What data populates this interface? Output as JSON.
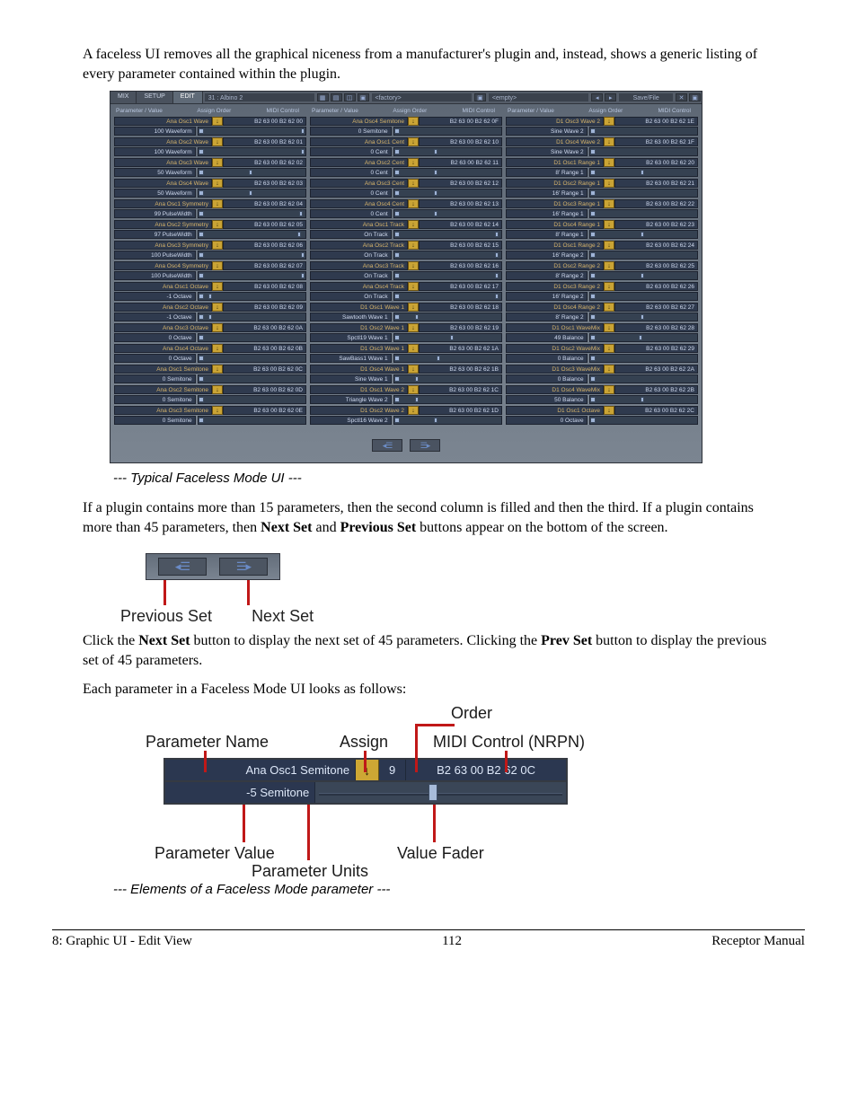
{
  "intro_para": "A faceless UI removes all the graphical niceness from a manufacturer's plugin and, instead, shows a generic listing of every parameter contained within the plugin.",
  "ui": {
    "tabs": [
      "MIX",
      "SETUP",
      "EDIT"
    ],
    "title_field": "31 : Albino 2",
    "factory_field": "<factory>",
    "empty_field": "<empty>",
    "savefile": "Save/File",
    "col_headers": [
      "Parameter / Value",
      "Assign Order",
      "MIDI Control"
    ],
    "columns": [
      [
        {
          "name": "Ana Osc1 Wave",
          "midi": "B2 63 00 B2 62 00",
          "val": "100 Waveform",
          "fpos": 98
        },
        {
          "name": "Ana Osc2 Wave",
          "midi": "B2 63 00 B2 62 01",
          "val": "100 Waveform",
          "fpos": 98
        },
        {
          "name": "Ana Osc3 Wave",
          "midi": "B2 63 00 B2 62 02",
          "val": "50 Waveform",
          "fpos": 50
        },
        {
          "name": "Ana Osc4 Wave",
          "midi": "B2 63 00 B2 62 03",
          "val": "50 Waveform",
          "fpos": 50
        },
        {
          "name": "Ana Osc1 Symmetry",
          "midi": "B2 63 00 B2 62 04",
          "val": "99 PulseWidth",
          "fpos": 97
        },
        {
          "name": "Ana Osc2 Symmetry",
          "midi": "B2 63 00 B2 62 05",
          "val": "97 PulseWidth",
          "fpos": 95
        },
        {
          "name": "Ana Osc3 Symmetry",
          "midi": "B2 63 00 B2 62 06",
          "val": "100 PulseWidth",
          "fpos": 98
        },
        {
          "name": "Ana Osc4 Symmetry",
          "midi": "B2 63 00 B2 62 07",
          "val": "100 PulseWidth",
          "fpos": 98
        },
        {
          "name": "Ana Osc1 Octave",
          "midi": "B2 63 00 B2 62 08",
          "val": "-1 Octave",
          "fpos": 12
        },
        {
          "name": "Ana Osc2 Octave",
          "midi": "B2 63 00 B2 62 09",
          "val": "-1 Octave",
          "fpos": 12
        },
        {
          "name": "Ana Osc3 Octave",
          "midi": "B2 63 00 B2 62 0A",
          "val": "0 Octave",
          "fpos": 2
        },
        {
          "name": "Ana Osc4 Octave",
          "midi": "B2 63 00 B2 62 0B",
          "val": "0 Octave",
          "fpos": 2
        },
        {
          "name": "Ana Osc1 Semitone",
          "midi": "B2 63 00 B2 62 0C",
          "val": "0 Semitone",
          "fpos": 2
        },
        {
          "name": "Ana Osc2 Semitone",
          "midi": "B2 63 00 B2 62 0D",
          "val": "0 Semitone",
          "fpos": 2
        },
        {
          "name": "Ana Osc3 Semitone",
          "midi": "B2 63 00 B2 62 0E",
          "val": "0 Semitone",
          "fpos": 2
        }
      ],
      [
        {
          "name": "Ana Osc4 Semitone",
          "midi": "B2 63 00 B2 62 0F",
          "val": "0 Semitone",
          "fpos": 2
        },
        {
          "name": "Ana Osc1 Cent",
          "midi": "B2 63 00 B2 62 10",
          "val": "0 Cent",
          "fpos": 40
        },
        {
          "name": "Ana Osc2 Cent",
          "midi": "B2 63 00 B2 62 11",
          "val": "0 Cent",
          "fpos": 40
        },
        {
          "name": "Ana Osc3 Cent",
          "midi": "B2 63 00 B2 62 12",
          "val": "0 Cent",
          "fpos": 40
        },
        {
          "name": "Ana Osc4 Cent",
          "midi": "B2 63 00 B2 62 13",
          "val": "0 Cent",
          "fpos": 40
        },
        {
          "name": "Ana Osc1 Track",
          "midi": "B2 63 00 B2 62 14",
          "val": "On  Track",
          "fpos": 97
        },
        {
          "name": "Ana Osc2 Track",
          "midi": "B2 63 00 B2 62 15",
          "val": "On  Track",
          "fpos": 97
        },
        {
          "name": "Ana Osc3 Track",
          "midi": "B2 63 00 B2 62 16",
          "val": "On  Track",
          "fpos": 97
        },
        {
          "name": "Ana Osc4 Track",
          "midi": "B2 63 00 B2 62 17",
          "val": "On  Track",
          "fpos": 97
        },
        {
          "name": "D1 Osc1 Wave 1",
          "midi": "B2 63 00 B2 62 18",
          "val": "Sawtooth Wave 1",
          "fpos": 22
        },
        {
          "name": "D1 Osc2 Wave 1",
          "midi": "B2 63 00 B2 62 19",
          "val": "Spctl19 Wave 1",
          "fpos": 55
        },
        {
          "name": "D1 Osc3 Wave 1",
          "midi": "B2 63 00 B2 62 1A",
          "val": "SawBass1 Wave 1",
          "fpos": 42
        },
        {
          "name": "D1 Osc4 Wave 1",
          "midi": "B2 63 00 B2 62 1B",
          "val": "Sine    Wave 1",
          "fpos": 22
        },
        {
          "name": "D1 Osc1 Wave 2",
          "midi": "B2 63 00 B2 62 1C",
          "val": "Triangle Wave 2",
          "fpos": 22
        },
        {
          "name": "D1 Osc2 Wave 2",
          "midi": "B2 63 00 B2 62 1D",
          "val": "Spctl16 Wave 2",
          "fpos": 40
        }
      ],
      [
        {
          "name": "D1 Osc3 Wave 2",
          "midi": "B2 63 00 B2 62 1E",
          "val": "Sine    Wave 2",
          "fpos": 2
        },
        {
          "name": "D1 Osc4 Wave 2",
          "midi": "B2 63 00 B2 62 1F",
          "val": "Sine    Wave 2",
          "fpos": 2
        },
        {
          "name": "D1 Osc1 Range 1",
          "midi": "B2 63 00 B2 62 20",
          "val": "8'  Range 1",
          "fpos": 50
        },
        {
          "name": "D1 Osc2 Range 1",
          "midi": "B2 63 00 B2 62 21",
          "val": "16'  Range 1",
          "fpos": 2
        },
        {
          "name": "D1 Osc3 Range 1",
          "midi": "B2 63 00 B2 62 22",
          "val": "16'  Range 1",
          "fpos": 2
        },
        {
          "name": "D1 Osc4 Range 1",
          "midi": "B2 63 00 B2 62 23",
          "val": "8'  Range 1",
          "fpos": 50
        },
        {
          "name": "D1 Osc1 Range 2",
          "midi": "B2 63 00 B2 62 24",
          "val": "16'  Range 2",
          "fpos": 2
        },
        {
          "name": "D1 Osc2 Range 2",
          "midi": "B2 63 00 B2 62 25",
          "val": "8'  Range 2",
          "fpos": 50
        },
        {
          "name": "D1 Osc3 Range 2",
          "midi": "B2 63 00 B2 62 26",
          "val": "16'  Range 2",
          "fpos": 2
        },
        {
          "name": "D1 Osc4 Range 2",
          "midi": "B2 63 00 B2 62 27",
          "val": "8'  Range 2",
          "fpos": 50
        },
        {
          "name": "D1 Osc1 WaveMix",
          "midi": "B2 63 00 B2 62 28",
          "val": "49 Balance",
          "fpos": 48
        },
        {
          "name": "D1 Osc2 WaveMix",
          "midi": "B2 63 00 B2 62 29",
          "val": "0 Balance",
          "fpos": 2
        },
        {
          "name": "D1 Osc3 WaveMix",
          "midi": "B2 63 00 B2 62 2A",
          "val": "0 Balance",
          "fpos": 2
        },
        {
          "name": "D1 Osc4 WaveMix",
          "midi": "B2 63 00 B2 62 2B",
          "val": "50 Balance",
          "fpos": 50
        },
        {
          "name": "D1 Osc1 Octave",
          "midi": "B2 63 00 B2 62 2C",
          "val": "0 Octave",
          "fpos": 2
        }
      ]
    ]
  },
  "caption1": "--- Typical Faceless Mode UI ---",
  "para2_a": "If a plugin contains more than 15 parameters, then the second column is filled and then the third. If a plugin contains more than 45 parameters, then ",
  "para2_next": "Next Set",
  "para2_and": " and ",
  "para2_prev": "Previous Set",
  "para2_b": " buttons appear on the bottom of the screen.",
  "prevnext": {
    "prev_label": "Previous Set",
    "next_label": "Next Set"
  },
  "para3_a": "Click the ",
  "para3_next": "Next Set",
  "para3_b": " button to display the next set of 45 parameters. Clicking the ",
  "para3_prev": "Prev Set",
  "para3_c": " button to display the previous set of 45 parameters.",
  "para4": "Each parameter in a Faceless Mode UI looks as follows:",
  "elem": {
    "labels": {
      "param_name": "Parameter Name",
      "assign": "Assign",
      "order": "Order",
      "midi": "MIDI Control (NRPN)",
      "param_value": "Parameter Value",
      "value_fader": "Value Fader",
      "param_units": "Parameter Units"
    },
    "row": {
      "name": "Ana Osc1 Semitone",
      "order": "9",
      "midi": "B2 63 00 B2 62 0C",
      "value": "-5 Semitone"
    }
  },
  "caption2": "--- Elements of a Faceless Mode parameter ---",
  "footer": {
    "left": "8: Graphic UI - Edit View",
    "center": "112",
    "right": "Receptor Manual"
  }
}
